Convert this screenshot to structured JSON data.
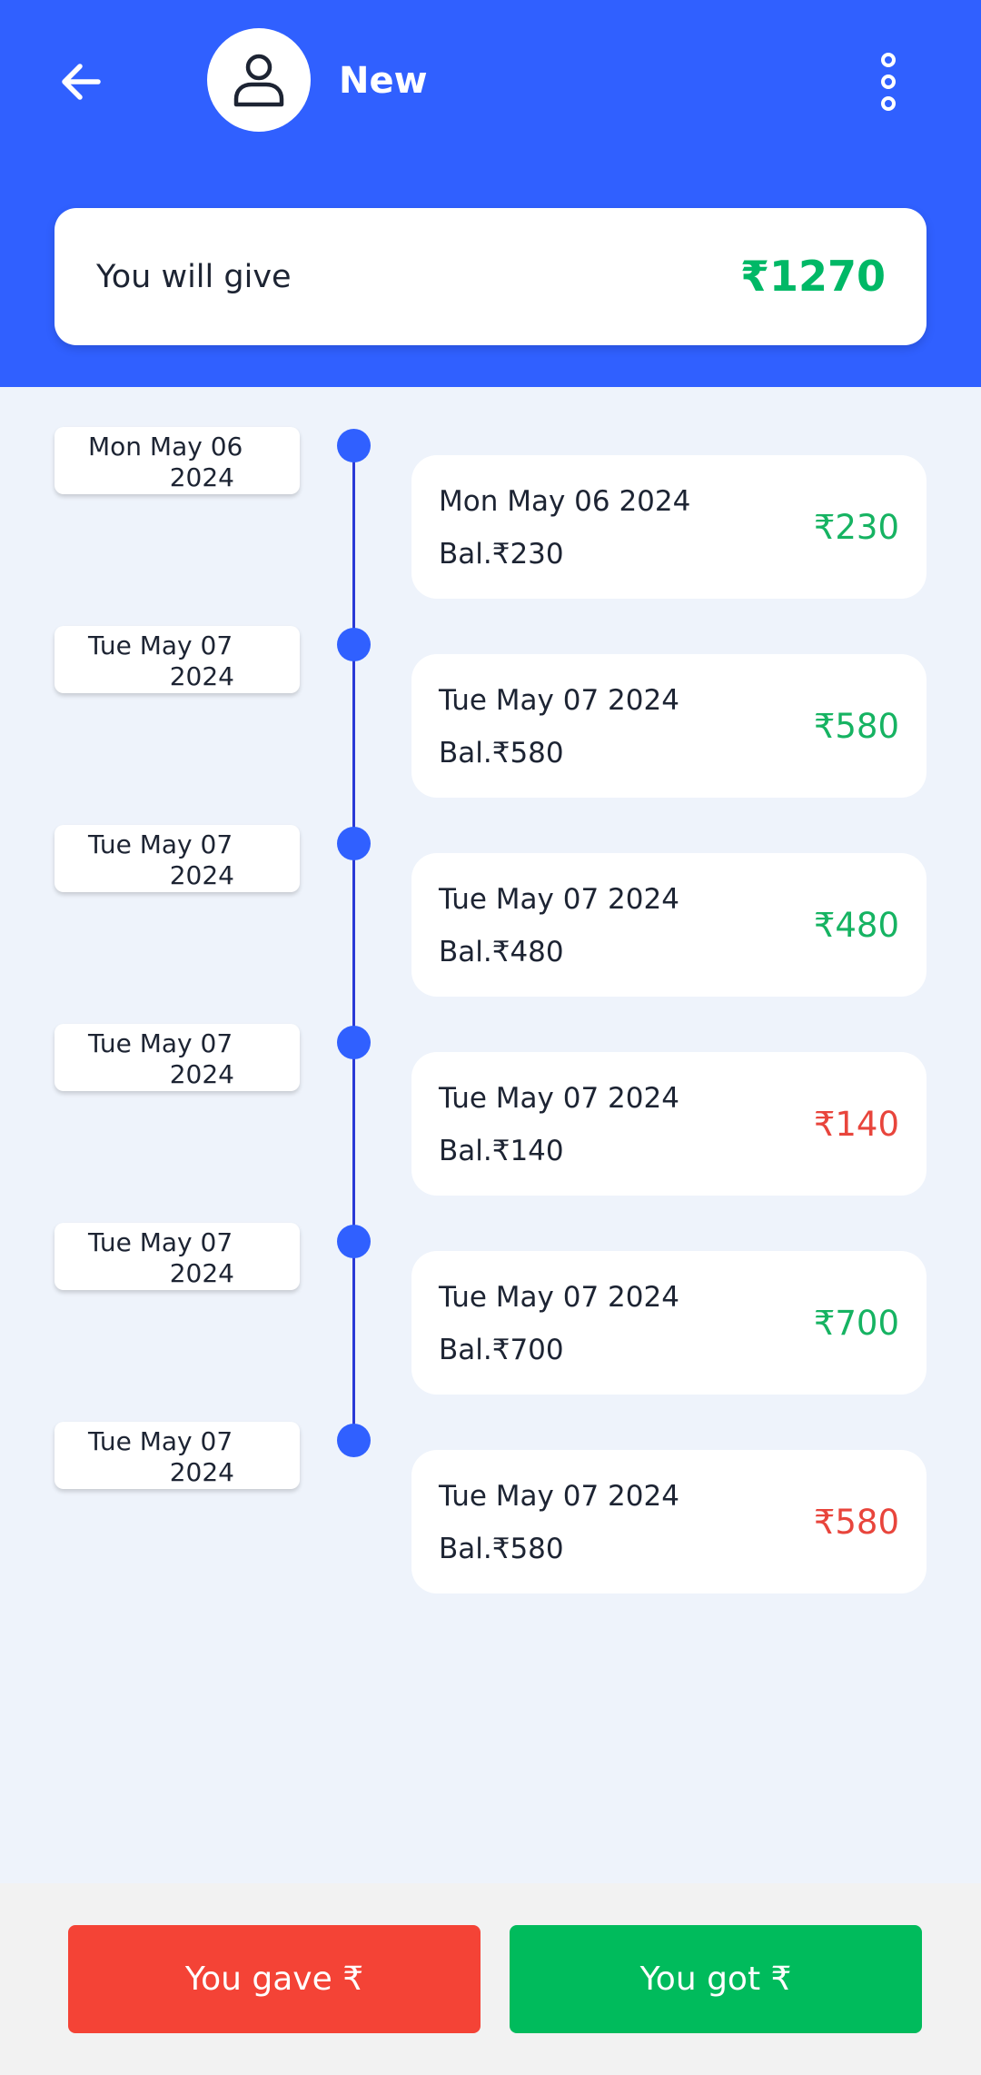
{
  "header": {
    "back_icon": "arrow-left-icon",
    "avatar_icon": "person-icon",
    "contact_name": "New",
    "more_icon": "more-vertical-icon",
    "background_color": "#3060ff"
  },
  "summary": {
    "label": "You will give",
    "amount": "₹1270",
    "amount_color": "#00b866"
  },
  "entries": [
    {
      "chip_line1": "Mon May 06",
      "chip_line2": "2024",
      "date": "Mon May 06 2024",
      "balance": "Bal.₹230",
      "amount": "₹230",
      "type": "got",
      "color": "#16b362"
    },
    {
      "chip_line1": "Tue May 07",
      "chip_line2": "2024",
      "date": "Tue May 07 2024",
      "balance": "Bal.₹580",
      "amount": "₹580",
      "type": "got",
      "color": "#16b362"
    },
    {
      "chip_line1": "Tue May 07",
      "chip_line2": "2024",
      "date": "Tue May 07 2024",
      "balance": "Bal.₹480",
      "amount": "₹480",
      "type": "got",
      "color": "#16b362"
    },
    {
      "chip_line1": "Tue May 07",
      "chip_line2": "2024",
      "date": "Tue May 07 2024",
      "balance": "Bal.₹140",
      "amount": "₹140",
      "type": "gave",
      "color": "#e8453c"
    },
    {
      "chip_line1": "Tue May 07",
      "chip_line2": "2024",
      "date": "Tue May 07 2024",
      "balance": "Bal.₹700",
      "amount": "₹700",
      "type": "got",
      "color": "#16b362"
    },
    {
      "chip_line1": "Tue May 07",
      "chip_line2": "2024",
      "date": "Tue May 07 2024",
      "balance": "Bal.₹580",
      "amount": "₹580",
      "type": "gave",
      "color": "#e8453c"
    }
  ],
  "actions": {
    "gave_label": "You gave ₹",
    "got_label": "You got ₹",
    "gave_color": "#f44336",
    "got_color": "#00bb5c"
  }
}
